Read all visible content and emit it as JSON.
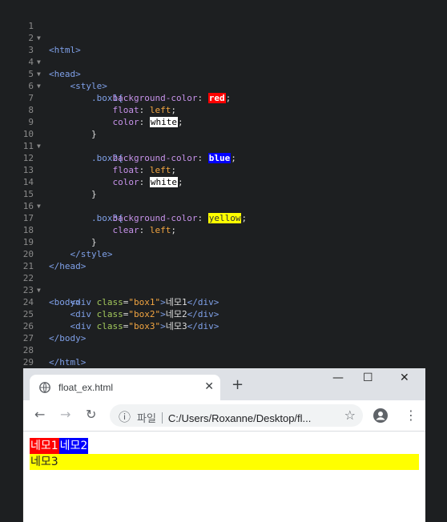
{
  "editor": {
    "line_numbers": [
      "1",
      "2",
      "3",
      "4",
      "5",
      "6",
      "7",
      "8",
      "9",
      "10",
      "11",
      "12",
      "13",
      "14",
      "15",
      "16",
      "17",
      "18",
      "19",
      "20",
      "21",
      "22",
      "23",
      "24",
      "25",
      "26",
      "27",
      "28",
      "29"
    ],
    "tokens": {
      "html_open": "<html>",
      "head_open": "<head>",
      "style_open": "<style>",
      "box1_sel": ".box1{",
      "box2_sel": ".box2{",
      "box3_sel": ".box3{",
      "prop_bg": "background-color",
      "prop_float": "float",
      "prop_color": "color",
      "prop_clear": "clear",
      "colon": ":",
      "semicolon": ";",
      "val_red": "red",
      "val_blue": "blue",
      "val_white": "white",
      "val_yellow": "yellow",
      "val_left": "left",
      "close_brace": "}",
      "style_close": "</style>",
      "head_close": "</head>",
      "body_open": "<body>",
      "div_open": "<div",
      "class_attr": "class",
      "eq": "=",
      "box1_str": "\"box1\"",
      "box2_str": "\"box2\"",
      "box3_str": "\"box3\"",
      "gt": ">",
      "text1": "네모1",
      "text2": "네모2",
      "text3": "네모3",
      "div_close": "</div>",
      "body_close": "</body>",
      "html_close": "</html>"
    },
    "colors": {
      "red": "#ff0000",
      "blue": "#0000ff",
      "white": "#ffffff",
      "yellow": "#ffff00"
    }
  },
  "browser": {
    "tab_title": "float_ex.html",
    "tab_close": "✕",
    "new_tab": "+",
    "minimize": "—",
    "maximize": "☐",
    "close": "✕",
    "back": "←",
    "forward": "→",
    "reload": "↻",
    "info": "ⓘ",
    "omnibox_label": "파일",
    "url": "C:/Users/Roxanne/Desktop/fl...",
    "star": "☆",
    "menu": "⋮",
    "boxes": {
      "box1": "네모1",
      "box2": "네모2",
      "box3": "네모3"
    }
  }
}
